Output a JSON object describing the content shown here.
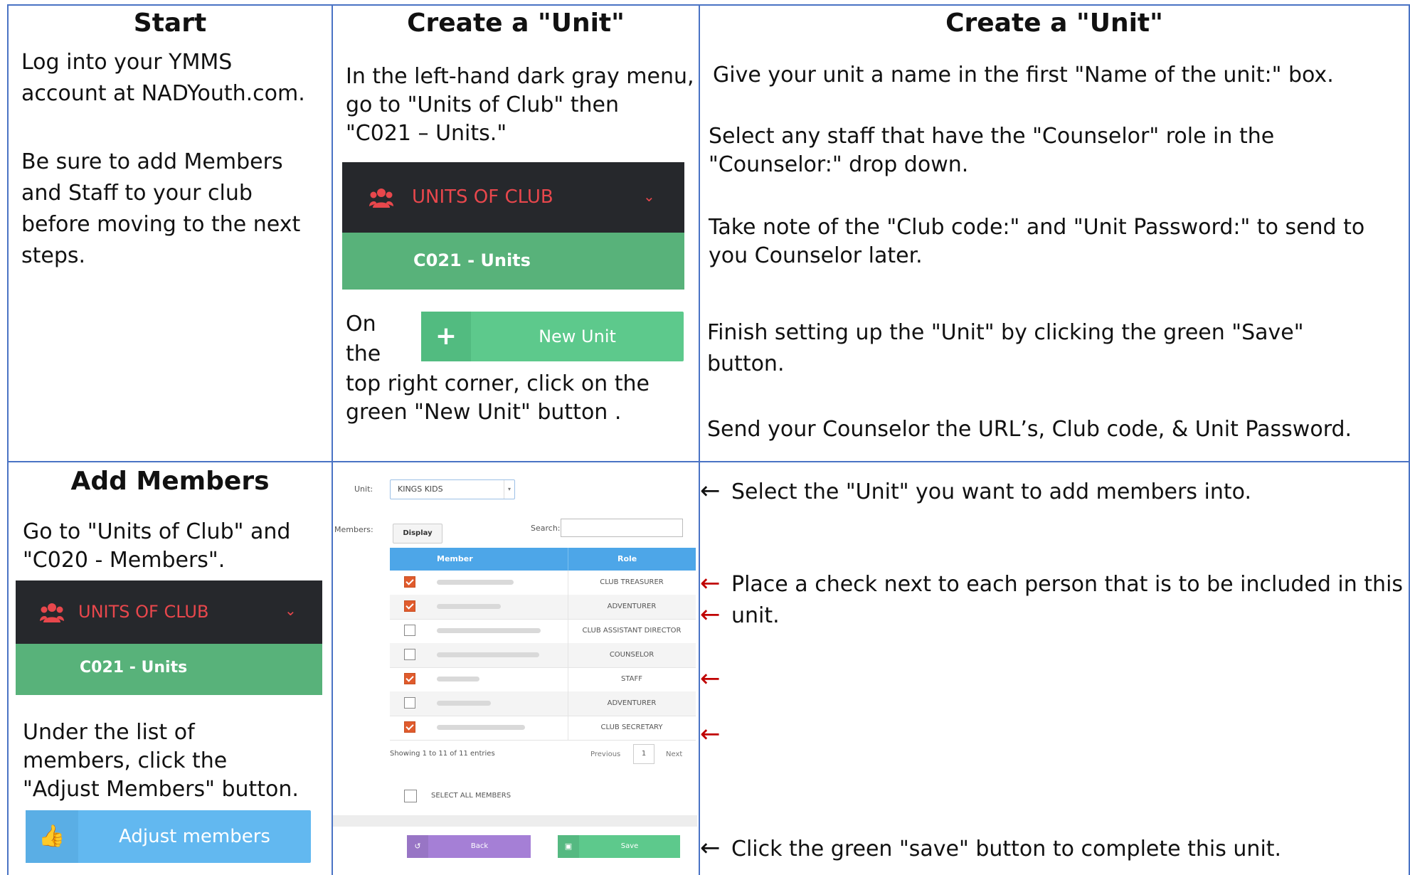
{
  "colors": {
    "grid": "#4a73c4",
    "menu_dark": "#26282c",
    "menu_green": "#58b27a",
    "menu_red": "#e8474c",
    "new_unit": "#5dc98c",
    "adjust": "#62b8f0",
    "check": "#e05b2d",
    "arrow_red": "#c00000"
  },
  "start": {
    "title": "Start",
    "p1": [
      "Log into your YMMS",
      "account at NADYouth.com."
    ],
    "p2": [
      "Be sure to add Members",
      "and Staff to your club",
      "before moving to the next",
      "steps."
    ]
  },
  "create1": {
    "title": "Create a \"Unit\"",
    "p1": [
      "In the left-hand dark gray menu,",
      "go to \"Units of Club\" then",
      "\"C021 – Units.\""
    ],
    "menu_label": "UNITS OF CLUB",
    "menu_sub": "C021 - Units",
    "on": "On",
    "the": "the",
    "new_unit_label": "New Unit",
    "p2": [
      "top right corner, click on the",
      "green \"New Unit\" button ."
    ]
  },
  "create2": {
    "title": "Create a \"Unit\"",
    "l1": "Give your unit a name in the first \"Name of the unit:\" box.",
    "l2": [
      "Select any staff that have the \"Counselor\" role in the",
      "\"Counselor:\" drop down."
    ],
    "l3": [
      "Take note of the \"Club code:\" and \"Unit Password:\" to send to",
      "you Counselor later."
    ],
    "l4": [
      "Finish setting up the \"Unit\" by clicking the green \"Save\"",
      "button."
    ],
    "l5": "Send your Counselor the URL’s,  Club code, & Unit Password."
  },
  "add": {
    "title": "Add Members",
    "p1": [
      "Go to \"Units of Club\" and",
      "\"C020 - Members\"."
    ],
    "menu_label": "UNITS OF CLUB",
    "menu_sub": "C021 - Units",
    "p2": [
      "Under the list of",
      "members, click the",
      "\"Adjust Members\" button."
    ],
    "adjust_label": "Adjust members"
  },
  "form": {
    "unit_label": "Unit:",
    "unit_value": "KINGS KIDS",
    "members_label": "Members:",
    "display_btn": "Display",
    "search_label": "Search:",
    "col_member": "Member",
    "col_role": "Role",
    "rows": [
      {
        "checked": true,
        "role": "CLUB TREASURER"
      },
      {
        "checked": true,
        "role": "ADVENTURER"
      },
      {
        "checked": false,
        "role": "CLUB ASSISTANT DIRECTOR"
      },
      {
        "checked": false,
        "role": "COUNSELOR"
      },
      {
        "checked": true,
        "role": "STAFF"
      },
      {
        "checked": false,
        "role": "ADVENTURER"
      },
      {
        "checked": true,
        "role": "CLUB SECRETARY"
      }
    ],
    "showing": "Showing 1 to 11 of 11 entries",
    "previous": "Previous",
    "page": "1",
    "next": "Next",
    "select_all": "SELECT ALL MEMBERS",
    "back": "Back",
    "save": "Save"
  },
  "notes": {
    "arrow": "←",
    "n1": "Select the \"Unit\" you want to add members into.",
    "n2": [
      "Place a check next to each person that is to be included in this",
      "unit."
    ],
    "n3": "Click the green \"save\" button to complete this unit."
  }
}
